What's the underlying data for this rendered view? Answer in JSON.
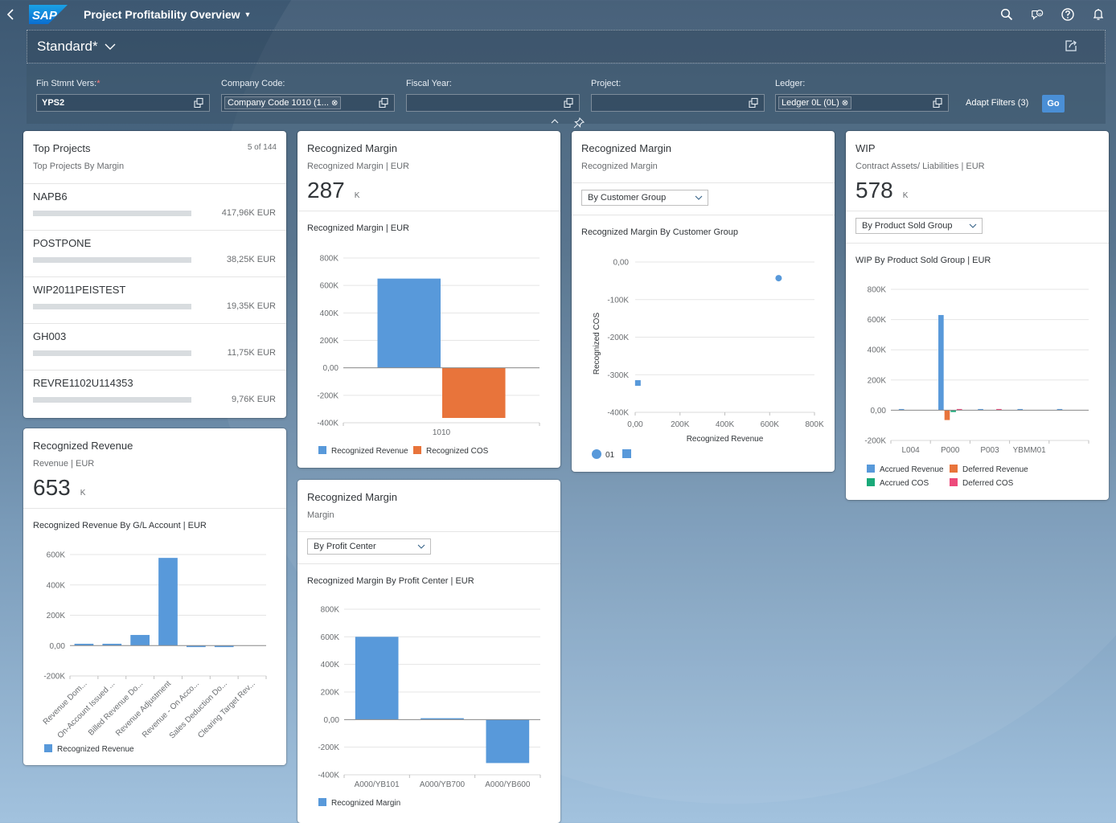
{
  "shell": {
    "back_icon": "chevron-left-icon",
    "logo": "SAP",
    "app_title": "Project Profitability Overview",
    "actions": [
      "search-icon",
      "feedback-icon",
      "help-icon",
      "notification-bell-icon"
    ]
  },
  "variant": {
    "name": "Standard*",
    "share_icon": "share-icon"
  },
  "filters": {
    "items": [
      {
        "label": "Fin Stmnt Vers:",
        "required": "*",
        "value": "YPS2",
        "token": ""
      },
      {
        "label": "Company Code:",
        "required": "",
        "value": "",
        "token": "Company Code 1010 (1..."
      },
      {
        "label": "Fiscal Year:",
        "required": "",
        "value": "",
        "token": ""
      },
      {
        "label": "Project:",
        "required": "",
        "value": "",
        "token": ""
      },
      {
        "label": "Ledger:",
        "required": "",
        "value": "",
        "token": "Ledger 0L (0L)"
      }
    ],
    "token_clear": "⊗",
    "adapt_filters": "Adapt Filters (3)",
    "go": "Go"
  },
  "colors": {
    "blue": "#5899da",
    "orange": "#e8743b",
    "green": "#19a979",
    "pink": "#ed4a7b",
    "go_button": "#4a8fd6"
  },
  "cards": {
    "top_projects": {
      "title": "Top Projects",
      "subtitle": "Top Projects By Margin",
      "count": "5 of 144",
      "items": [
        {
          "name": "NAPB6",
          "value": "417,96K EUR",
          "fill": 0
        },
        {
          "name": "POSTPONE",
          "value": "38,25K EUR",
          "fill": 0
        },
        {
          "name": "WIP2011PEISTEST",
          "value": "19,35K EUR",
          "fill": 0
        },
        {
          "name": "GH003",
          "value": "11,75K EUR",
          "fill": 0
        },
        {
          "name": "REVRE1102U114353",
          "value": "9,76K EUR",
          "fill": 0
        }
      ]
    },
    "recognized_margin_1": {
      "title": "Recognized Margin",
      "subtitle": "Recognized Margin | EUR",
      "kpi_value": "287",
      "kpi_unit": "K",
      "chart_title": "Recognized Margin | EUR"
    },
    "recognized_margin_2": {
      "title": "Recognized Margin",
      "subtitle": "Recognized Margin",
      "select": "By Customer Group",
      "chart_title": "Recognized Margin By Customer Group"
    },
    "wip": {
      "title": "WIP",
      "subtitle": "Contract Assets/ Liabilities | EUR",
      "kpi_value": "578",
      "kpi_unit": "K",
      "select": "By Product Sold Group",
      "chart_title": "WIP By Product Sold Group | EUR"
    },
    "recognized_revenue": {
      "title": "Recognized Revenue",
      "subtitle": "Revenue | EUR",
      "kpi_value": "653",
      "kpi_unit": "K",
      "chart_title": "Recognized Revenue By G/L Account | EUR"
    },
    "recognized_margin_3": {
      "title": "Recognized Margin",
      "subtitle": "Margin",
      "select": "By Profit Center",
      "chart_title": "Recognized Margin By Profit Center | EUR"
    }
  },
  "chart_data": [
    {
      "id": "margin_by_company",
      "type": "bar",
      "title": "Recognized Margin | EUR",
      "categories": [
        "1010"
      ],
      "series": [
        {
          "name": "Recognized Revenue",
          "color": "#5899da",
          "values": [
            650000
          ]
        },
        {
          "name": "Recognized COS",
          "color": "#e8743b",
          "values": [
            -365000
          ]
        }
      ],
      "ylim": [
        -400000,
        800000
      ],
      "yticks": [
        "800K",
        "600K",
        "400K",
        "200K",
        "0,00",
        "-200K",
        "-400K"
      ],
      "ytick_values": [
        800000,
        600000,
        400000,
        200000,
        0,
        -200000,
        -400000
      ],
      "grid": true,
      "legend": "bottom-left"
    },
    {
      "id": "margin_by_customer_group",
      "type": "scatter",
      "title": "Recognized Margin By Customer Group",
      "xlabel": "Recognized Revenue",
      "ylabel": "Recognized COS",
      "xlim": [
        0,
        800000
      ],
      "ylim": [
        -400000,
        0
      ],
      "xticks": [
        "0,00",
        "200K",
        "400K",
        "600K",
        "800K"
      ],
      "xtick_values": [
        0,
        200000,
        400000,
        600000,
        800000
      ],
      "yticks": [
        "0,00",
        "-100K",
        "-200K",
        "-300K",
        "-400K"
      ],
      "ytick_values": [
        0,
        -100000,
        -200000,
        -300000,
        -400000
      ],
      "series": [
        {
          "name": "01",
          "marker": "circle",
          "color": "#5899da",
          "points": [
            [
              640000,
              -43000
            ]
          ]
        },
        {
          "name": "",
          "marker": "square",
          "color": "#5899da",
          "points": [
            [
              12000,
              -322000
            ]
          ]
        }
      ],
      "grid": true,
      "legend": "bottom-left"
    },
    {
      "id": "wip_by_product_sold_group",
      "type": "bar",
      "title": "WIP By Product Sold Group | EUR",
      "categories": [
        "L004",
        "P000",
        "P003",
        "YBMM01",
        ""
      ],
      "series": [
        {
          "name": "Accrued Revenue",
          "color": "#5899da",
          "values": [
            8000,
            630000,
            8000,
            8000,
            8000
          ]
        },
        {
          "name": "Deferred Revenue",
          "color": "#e8743b",
          "values": [
            0,
            -65000,
            0,
            0,
            0
          ]
        },
        {
          "name": "Accrued COS",
          "color": "#19a979",
          "values": [
            0,
            -12000,
            0,
            0,
            0
          ]
        },
        {
          "name": "Deferred COS",
          "color": "#ed4a7b",
          "values": [
            0,
            8000,
            8000,
            0,
            0
          ]
        }
      ],
      "ylim": [
        -200000,
        800000
      ],
      "yticks": [
        "800K",
        "600K",
        "400K",
        "200K",
        "0,00",
        "-200K"
      ],
      "ytick_values": [
        800000,
        600000,
        400000,
        200000,
        0,
        -200000
      ],
      "grid": true,
      "legend": "bottom-left"
    },
    {
      "id": "revenue_by_gl_account",
      "type": "bar",
      "title": "Recognized Revenue By G/L Account | EUR",
      "categories": [
        "Revenue Dom...",
        "On-Account Issued ...",
        "Billed Revenue Do...",
        "Revenue Adjustment",
        "Revenue - On Acco...",
        "Sales Deduction Do...",
        "Clearing Target Rev..."
      ],
      "series": [
        {
          "name": "Recognized Revenue",
          "color": "#5899da",
          "values": [
            12000,
            12000,
            70000,
            578000,
            -10000,
            -10000,
            0
          ]
        }
      ],
      "ylim": [
        -200000,
        600000
      ],
      "yticks": [
        "600K",
        "400K",
        "200K",
        "0,00",
        "-200K"
      ],
      "ytick_values": [
        600000,
        400000,
        200000,
        0,
        -200000
      ],
      "grid": true,
      "legend": "bottom-left"
    },
    {
      "id": "margin_by_profit_center",
      "type": "bar",
      "title": "Recognized Margin By Profit Center | EUR",
      "categories": [
        "A000/YB101",
        "A000/YB700",
        "A000/YB600"
      ],
      "series": [
        {
          "name": "Recognized Margin",
          "color": "#5899da",
          "values": [
            600000,
            10000,
            -315000
          ]
        }
      ],
      "ylim": [
        -400000,
        800000
      ],
      "yticks": [
        "800K",
        "600K",
        "400K",
        "200K",
        "0,00",
        "-200K",
        "-400K"
      ],
      "ytick_values": [
        800000,
        600000,
        400000,
        200000,
        0,
        -200000,
        -400000
      ],
      "grid": true,
      "legend": "bottom-left"
    }
  ]
}
